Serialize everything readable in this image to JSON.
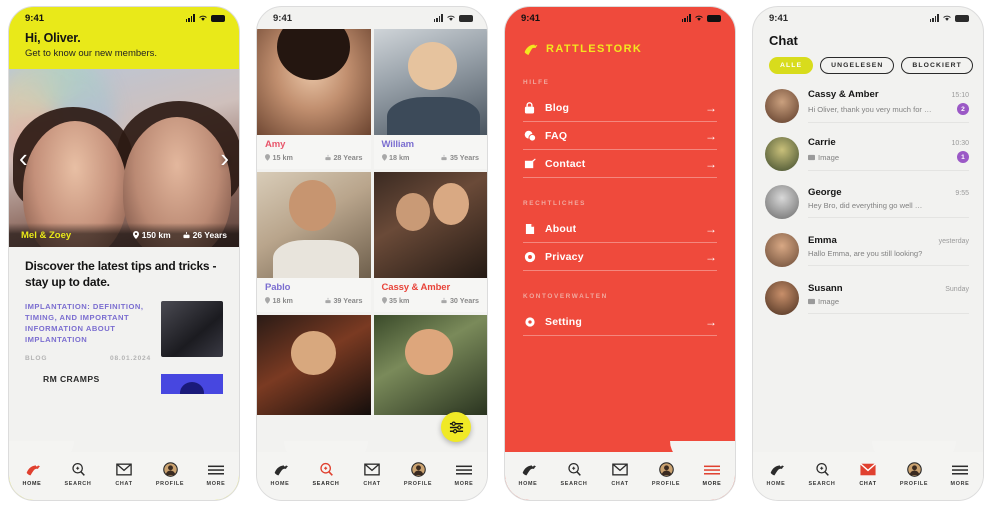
{
  "colors": {
    "yellow": "#e9e919",
    "red": "#ef4a3c",
    "purple": "#7b6ed0",
    "badge_purple": "#9b59c6",
    "chip_yellow": "#d8dc1c"
  },
  "status_bar": {
    "time": "9:41",
    "signal": "signal-bars",
    "wifi": "wifi",
    "battery": "battery-full"
  },
  "phone1": {
    "greeting": "Hi, Oliver.",
    "subtitle": "Get to know our new members.",
    "hero": {
      "name": "Mel & Zoey",
      "distance": "150 km",
      "age": "26 Years",
      "prev_label": "‹",
      "next_label": "›"
    },
    "section_title": "Discover the latest tips and tricks - stay up to date.",
    "blog_posts": [
      {
        "headline": "IMPLANTATION: DEFINITION, TIMING, AND IMPORTANT INFORMATION ABOUT IMPLANTATION",
        "category": "BLOG",
        "date": "08.01.2024"
      },
      {
        "headline": "RM CRAMPS",
        "category": "",
        "date": ""
      }
    ]
  },
  "phone2": {
    "members": [
      {
        "name": "Amy",
        "distance": "15 km",
        "age": "28 Years",
        "color": "#e8566b",
        "photo": "ph-amy"
      },
      {
        "name": "William",
        "distance": "18 km",
        "age": "35 Years",
        "color": "#7b6ed0",
        "photo": "ph-will"
      },
      {
        "name": "Pablo",
        "distance": "18 km",
        "age": "39 Years",
        "color": "#7b6ed0",
        "photo": "ph-pablo"
      },
      {
        "name": "Cassy & Amber",
        "distance": "35 km",
        "age": "30 Years",
        "color": "#e8443a",
        "photo": "ph-cassy"
      },
      {
        "name": "",
        "distance": "",
        "age": "",
        "color": "#7b6ed0",
        "photo": "ph-man2"
      },
      {
        "name": "",
        "distance": "",
        "age": "",
        "color": "#7b6ed0",
        "photo": "ph-woman2"
      }
    ],
    "filter_button": "filter-sliders-icon"
  },
  "phone3": {
    "logo": "RATTLESTORK",
    "sections": [
      {
        "title": "HILFE",
        "items": [
          {
            "label": "Blog",
            "icon": "lock-icon"
          },
          {
            "label": "FAQ",
            "icon": "chat-bubbles-icon"
          },
          {
            "label": "Contact",
            "icon": "pencil-icon"
          }
        ]
      },
      {
        "title": "RECHTLICHES",
        "items": [
          {
            "label": "About",
            "icon": "document-icon"
          },
          {
            "label": "Privacy",
            "icon": "shield-icon"
          }
        ]
      },
      {
        "title": "KONTOVERWALTEN",
        "items": [
          {
            "label": "Setting",
            "icon": "gear-icon"
          }
        ]
      }
    ],
    "arrow": "→"
  },
  "phone4": {
    "title": "Chat",
    "filters": [
      {
        "label": "ALLE",
        "active": true
      },
      {
        "label": "UNGELESEN",
        "active": false
      },
      {
        "label": "BLOCKIERT",
        "active": false
      }
    ],
    "conversations": [
      {
        "name": "Cassy & Amber",
        "preview": "Hi Oliver, thank you very much for  …",
        "time": "15:10",
        "unread": "2",
        "has_image": false,
        "avatar": "av-a"
      },
      {
        "name": "Carrie",
        "preview": "Image",
        "time": "10:30",
        "unread": "1",
        "has_image": true,
        "avatar": "av-b"
      },
      {
        "name": "George",
        "preview": "Hey Bro, did everything go well …",
        "time": "9:55",
        "unread": "",
        "has_image": false,
        "avatar": "av-c"
      },
      {
        "name": "Emma",
        "preview": "Hallo Emma, are you still looking?",
        "time": "yesterday",
        "unread": "",
        "has_image": false,
        "avatar": "av-d"
      },
      {
        "name": "Susann",
        "preview": "Image",
        "time": "Sunday",
        "unread": "",
        "has_image": true,
        "avatar": "av-e"
      }
    ]
  },
  "tabbar": {
    "items": [
      {
        "label": "HOME",
        "icon": "stork-icon"
      },
      {
        "label": "SEARCH",
        "icon": "search-icon"
      },
      {
        "label": "CHAT",
        "icon": "envelope-icon"
      },
      {
        "label": "PROFILE",
        "icon": "avatar-icon"
      },
      {
        "label": "MORE",
        "icon": "hamburger-icon"
      }
    ],
    "active_by_phone": [
      "HOME",
      "SEARCH",
      "MORE",
      "CHAT"
    ]
  }
}
